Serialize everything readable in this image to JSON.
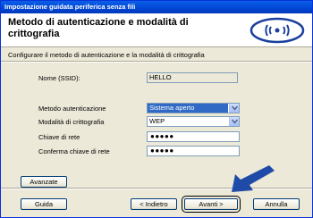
{
  "window": {
    "title": "Impostazione guidata periferica senza fili"
  },
  "header": {
    "title": "Metodo di autenticazione e modalità di crittografia"
  },
  "subtitle": "Configurare il metodo di autenticazione e la modalità di crittografia",
  "form": {
    "ssid_label": "Nome (SSID):",
    "ssid_value": "HELLO",
    "auth_label": "Metodo autenticazione",
    "auth_value": "Sistema aperto",
    "enc_label": "Modalità di crittografia",
    "enc_value": "WEP",
    "key_label": "Chiave di rete",
    "key_value": "●●●●●",
    "confirm_label": "Conferma chiave di rete",
    "confirm_value": "●●●●●"
  },
  "buttons": {
    "advanced": "Avanzate",
    "help": "Guida",
    "back": "< Indietro",
    "next": "Avanti >",
    "cancel": "Annulla"
  },
  "colors": {
    "titlebar": "#0a5fe8",
    "selection": "#316ac5",
    "arrow": "#1f4aa8"
  },
  "icons": {
    "logo": "wireless-logo-icon",
    "arrow": "pointer-arrow-icon"
  }
}
